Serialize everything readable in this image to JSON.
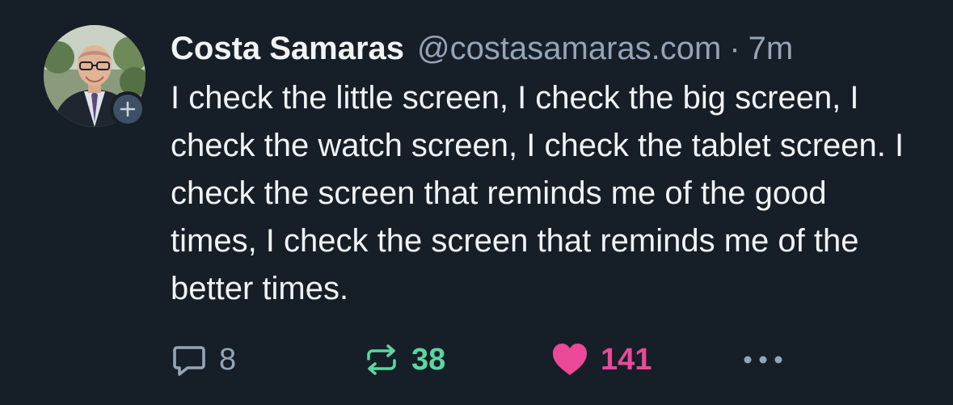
{
  "post": {
    "author": {
      "display_name": "Costa Samaras",
      "handle": "@costasamaras.com",
      "separator": "·",
      "time": "7m"
    },
    "text": "I check the little screen, I check the big screen, I check the watch screen, I check the tablet screen. I check the screen that reminds me of the good times, I check the screen that reminds me of the better times.",
    "actions": {
      "reply_count": "8",
      "repost_count": "38",
      "like_count": "141"
    }
  },
  "colors": {
    "background": "#161e27",
    "text": "#f1f3f5",
    "muted": "#93a5b7",
    "repost": "#5cd6a0",
    "like": "#ec4899"
  },
  "icons": {
    "reply": "speech-bubble-icon",
    "repost": "repost-arrows-icon",
    "like": "heart-icon",
    "more": "ellipsis-icon",
    "follow": "plus-icon"
  }
}
